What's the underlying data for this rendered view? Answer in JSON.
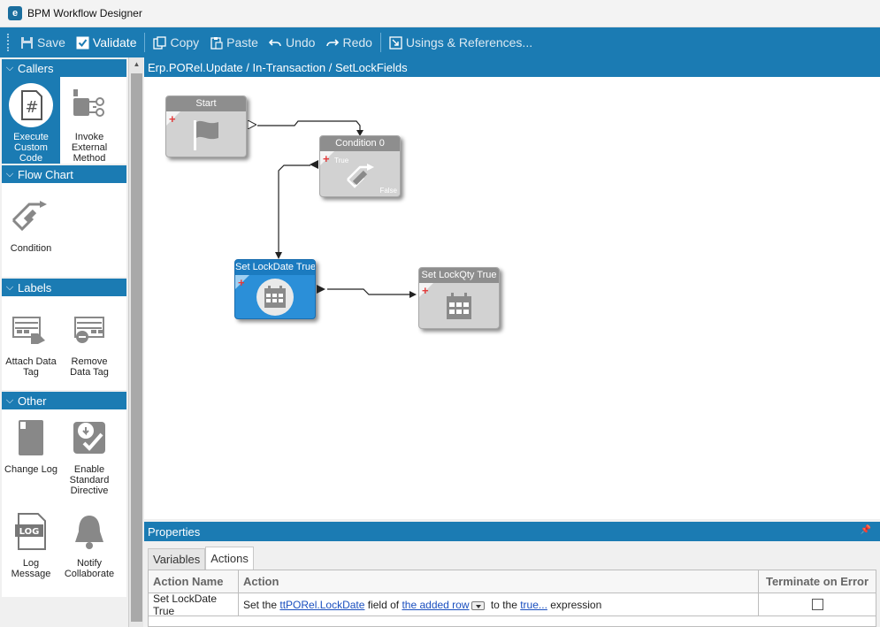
{
  "window": {
    "title": "BPM Workflow Designer",
    "logo_letter": "e"
  },
  "toolbar": {
    "save": "Save",
    "validate": "Validate",
    "copy": "Copy",
    "paste": "Paste",
    "undo": "Undo",
    "redo": "Redo",
    "usings": "Usings & References..."
  },
  "sidebar": {
    "callers": {
      "header": "Callers",
      "items": [
        "Execute Custom Code",
        "Invoke External Method"
      ]
    },
    "flowchart": {
      "header": "Flow Chart",
      "items": [
        "Condition"
      ]
    },
    "labels": {
      "header": "Labels",
      "items": [
        "Attach Data Tag",
        "Remove Data Tag"
      ]
    },
    "other": {
      "header": "Other",
      "items": [
        "Change Log",
        "Enable Standard Directive",
        "Log Message",
        "Notify Collaborate"
      ]
    }
  },
  "canvas": {
    "breadcrumb": "Erp.PORel.Update / In-Transaction / SetLockFields",
    "nodes": {
      "start": "Start",
      "condition": "Condition 0",
      "condition_true": "True",
      "condition_false": "False",
      "set_lockdate": "Set LockDate True",
      "set_lockqty": "Set LockQty True"
    }
  },
  "properties": {
    "header": "Properties",
    "tabs": [
      "Variables",
      "Actions"
    ],
    "active_tab": "Actions",
    "columns": [
      "Action Name",
      "Action",
      "Terminate on Error"
    ],
    "row": {
      "name": "Set LockDate True",
      "t1": "Set the ",
      "field": "ttPORel.LockDate",
      "t2": " field of ",
      "row_link": "the added row",
      "t3": " to the ",
      "expr": "true...",
      "t4": " expression",
      "terminate": false
    }
  },
  "colors": {
    "accent": "#1b7bb3",
    "node_active": "#2b8fd8",
    "node_gray": "#d2d2d2"
  }
}
